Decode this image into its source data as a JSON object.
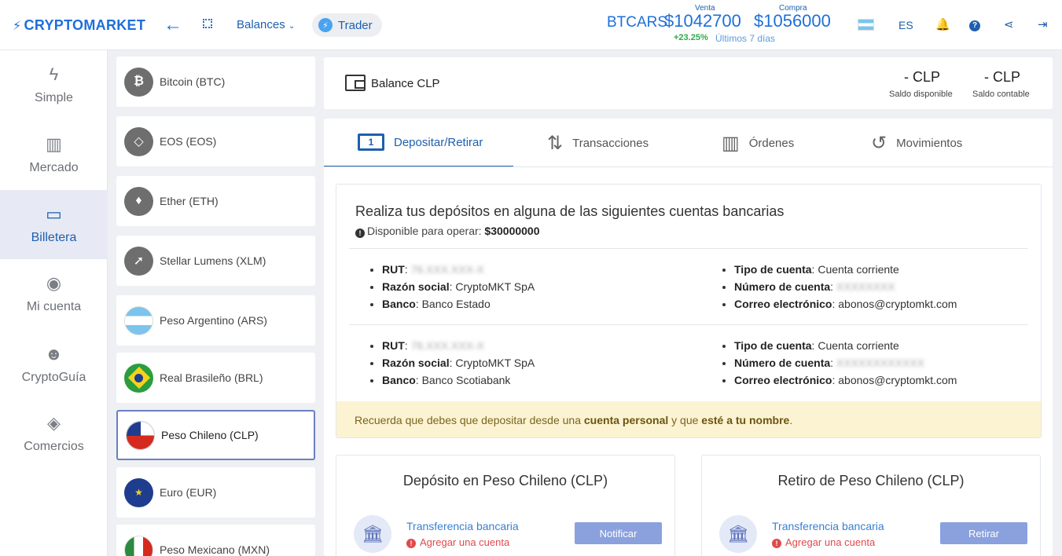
{
  "header": {
    "logo_text": "CRYPTOMARKET",
    "balances_label": "Balances",
    "trader_label": "Trader",
    "pair": "BTCARS",
    "sell_label": "Venta",
    "sell_price": "$1042700",
    "buy_label": "Compra",
    "buy_price": "$1056000",
    "change": "+23.25%",
    "period": "Últimos 7 días",
    "language": "ES"
  },
  "sidebar": {
    "items": [
      {
        "label": "Simple",
        "icon": "bolt-icon"
      },
      {
        "label": "Mercado",
        "icon": "bar-chart-icon"
      },
      {
        "label": "Billetera",
        "icon": "wallet-icon"
      },
      {
        "label": "Mi cuenta",
        "icon": "user-icon"
      },
      {
        "label": "CryptoGuía",
        "icon": "group-icon"
      },
      {
        "label": "Comercios",
        "icon": "store-icon"
      }
    ],
    "active_index": 2
  },
  "currencies": [
    {
      "label": "Bitcoin (BTC)",
      "glyph": "₿"
    },
    {
      "label": "EOS (EOS)",
      "glyph": "◇"
    },
    {
      "label": "Ether (ETH)",
      "glyph": "♦"
    },
    {
      "label": "Stellar Lumens (XLM)",
      "glyph": "➚"
    },
    {
      "label": "Peso Argentino (ARS)",
      "glyph": ""
    },
    {
      "label": "Real Brasileño (BRL)",
      "glyph": ""
    },
    {
      "label": "Peso Chileno (CLP)",
      "glyph": ""
    },
    {
      "label": "Euro (EUR)",
      "glyph": "★"
    },
    {
      "label": "Peso Mexicano (MXN)",
      "glyph": ""
    }
  ],
  "balance": {
    "title": "Balance CLP",
    "available_value": "- CLP",
    "available_label": "Saldo disponible",
    "accounting_value": "- CLP",
    "accounting_label": "Saldo contable"
  },
  "tabs": [
    {
      "label": "Depositar/Retirar",
      "icon": "banknote-icon"
    },
    {
      "label": "Transacciones",
      "icon": "transfer-arrows-icon"
    },
    {
      "label": "Órdenes",
      "icon": "bar-chart-icon"
    },
    {
      "label": "Movimientos",
      "icon": "history-icon"
    }
  ],
  "deposit": {
    "title": "Realiza tus depósitos en alguna de las siguientes cuentas bancarias",
    "available_label": "Disponible para operar:",
    "available_value": "$30000000",
    "labels": {
      "rut": "RUT",
      "razon": "Razón social",
      "banco": "Banco",
      "tipo": "Tipo de cuenta",
      "numero": "Número de cuenta",
      "correo": "Correo electrónico"
    },
    "accounts": [
      {
        "rut": "76.XXX.XXX-X",
        "razon": "CryptoMKT SpA",
        "banco": "Banco Estado",
        "tipo": "Cuenta corriente",
        "numero": "XXXXXXXX",
        "correo": "abonos@cryptomkt.com"
      },
      {
        "rut": "76.XXX.XXX-X",
        "razon": "CryptoMKT SpA",
        "banco": "Banco Scotiabank",
        "tipo": "Cuenta corriente",
        "numero": "XXXXXXXXXXXX",
        "correo": "abonos@cryptomkt.com"
      }
    ],
    "warning_pre": "Recuerda que debes que depositar desde una",
    "warning_b1": "cuenta personal",
    "warning_mid": "y que",
    "warning_b2": "esté a tu nombre",
    "warning_end": "."
  },
  "deposit_card": {
    "title": "Depósito en Peso Chileno (CLP)",
    "method": "Transferencia bancaria",
    "add_account": "Agregar una cuenta",
    "button": "Notificar"
  },
  "withdraw_card": {
    "title": "Retiro de Peso Chileno (CLP)",
    "method": "Transferencia bancaria",
    "add_account": "Agregar una cuenta",
    "button": "Retirar"
  },
  "colors": {
    "brand": "#1e6fd9",
    "accent_button": "#8aa1dd",
    "warning_bg": "#fcf3d2",
    "positive": "#2eaa4a",
    "error": "#e04a4a"
  }
}
